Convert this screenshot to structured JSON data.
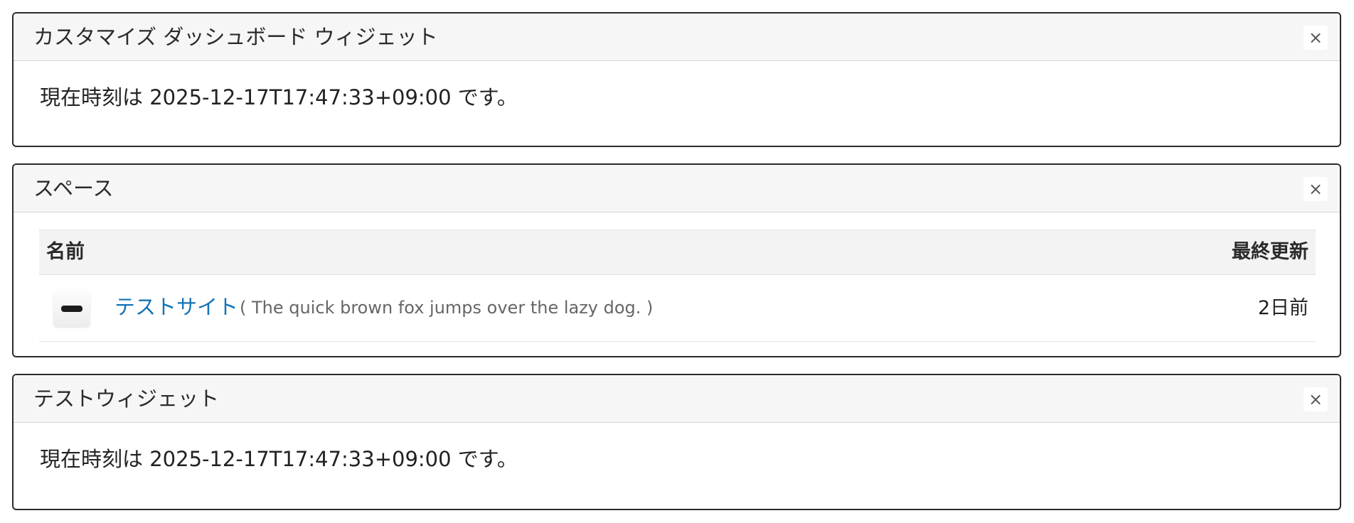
{
  "widgets": [
    {
      "title": "カスタマイズ ダッシュボード ウィジェット",
      "close": "×",
      "body": "現在時刻は 2025-12-17T17:47:33+09:00 です。"
    },
    {
      "title": "スペース",
      "close": "×",
      "table": {
        "headers": {
          "name": "名前",
          "updated": "最終更新"
        },
        "rows": [
          {
            "name": "テストサイト",
            "description": "( The quick brown fox jumps over the lazy dog. )",
            "updated": "2日前",
            "icon": "site-icon"
          }
        ]
      }
    },
    {
      "title": "テストウィジェット",
      "close": "×",
      "body": "現在時刻は 2025-12-17T17:47:33+09:00 です。"
    }
  ],
  "colors": {
    "link": "#1673b5",
    "header_bg": "#f6f6f7",
    "border": "#2b2b2b"
  }
}
